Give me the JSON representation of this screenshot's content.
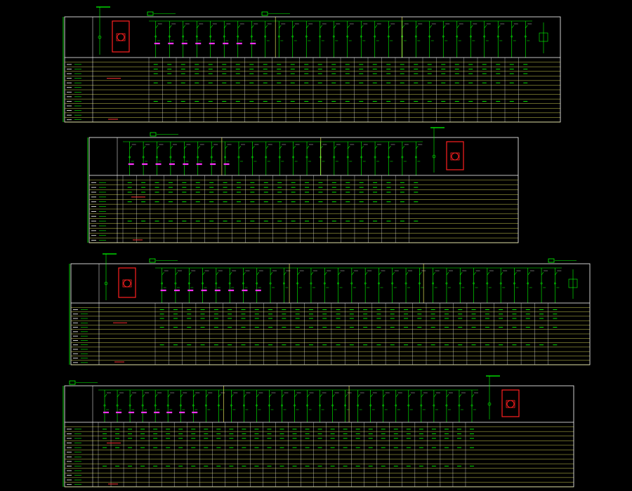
{
  "drawing": {
    "background": "#000000",
    "colors": {
      "frame": "#ffffff",
      "grid": "#ffff66",
      "wiring": "#00ff00",
      "breaker_bus": "#ff33ff",
      "transformer": "#ff2020",
      "text": "#ffffff",
      "note": "#ff3333"
    },
    "panels": [
      {
        "id": "row-1",
        "header_tags": [
          "1",
          "2"
        ],
        "feeder_count": 28,
        "transformer_side": "left",
        "has_incoming_right": true
      },
      {
        "id": "row-2",
        "header_tags": [
          "3"
        ],
        "feeder_count": 22,
        "transformer_side": "right",
        "has_incoming_left": true
      },
      {
        "id": "row-3",
        "header_tags": [
          "4",
          "5"
        ],
        "feeder_count": 30,
        "transformer_side": "left",
        "has_incoming_right": true
      },
      {
        "id": "row-4",
        "header_tags": [
          "6"
        ],
        "feeder_count": 30,
        "transformer_side": "right",
        "has_incoming_left": true
      }
    ],
    "icons": [
      "breaker-icon",
      "transformer-icon",
      "meter-icon",
      "ground-icon"
    ]
  }
}
